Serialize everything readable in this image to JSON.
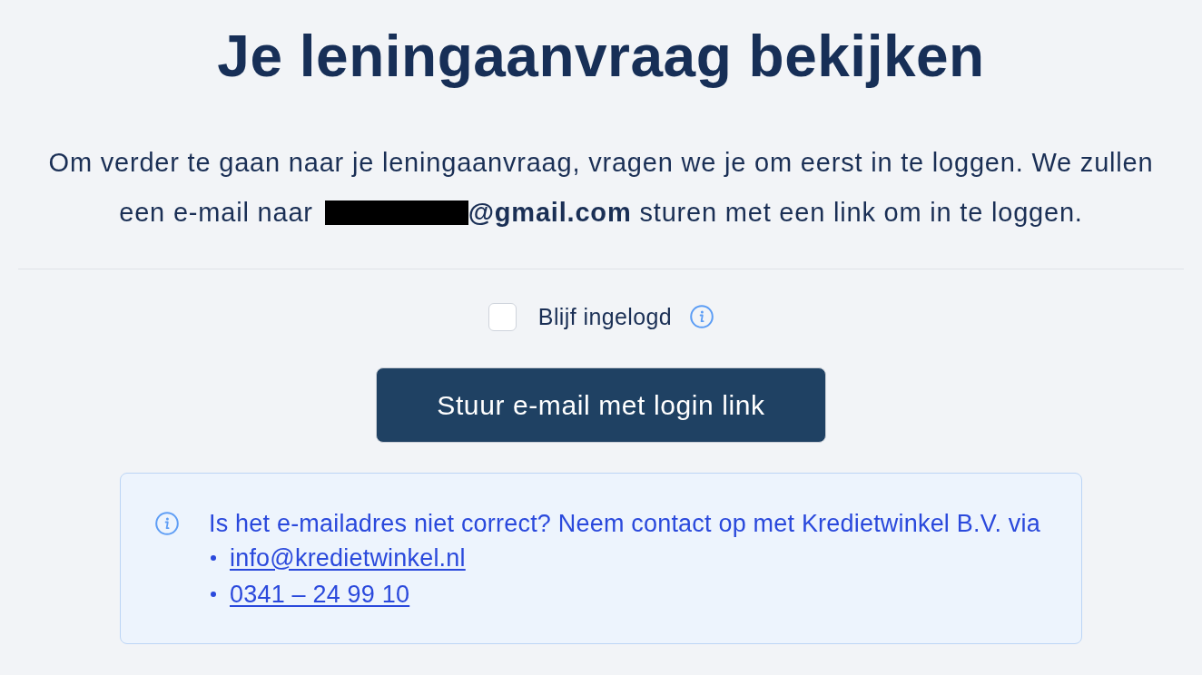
{
  "title": "Je leningaanvraag bekijken",
  "intro": {
    "line_1": "Om verder te gaan naar je leningaanvraag, vragen we je om eerst in te loggen. We zullen",
    "line_2_start": "een e-mail naar",
    "email": "@gmail.com",
    "line_2_end": "sturen met een link om in te loggen."
  },
  "stay_logged_in": {
    "label": "Blijf ingelogd",
    "checked": false
  },
  "submit_button": "Stuur e-mail met login link",
  "notice": {
    "text": "Is het e-mailadres niet correct? Neem contact op met Kredietwinkel B.V. via",
    "contacts": [
      "info@kredietwinkel.nl",
      "0341 – 24 99 10"
    ]
  }
}
